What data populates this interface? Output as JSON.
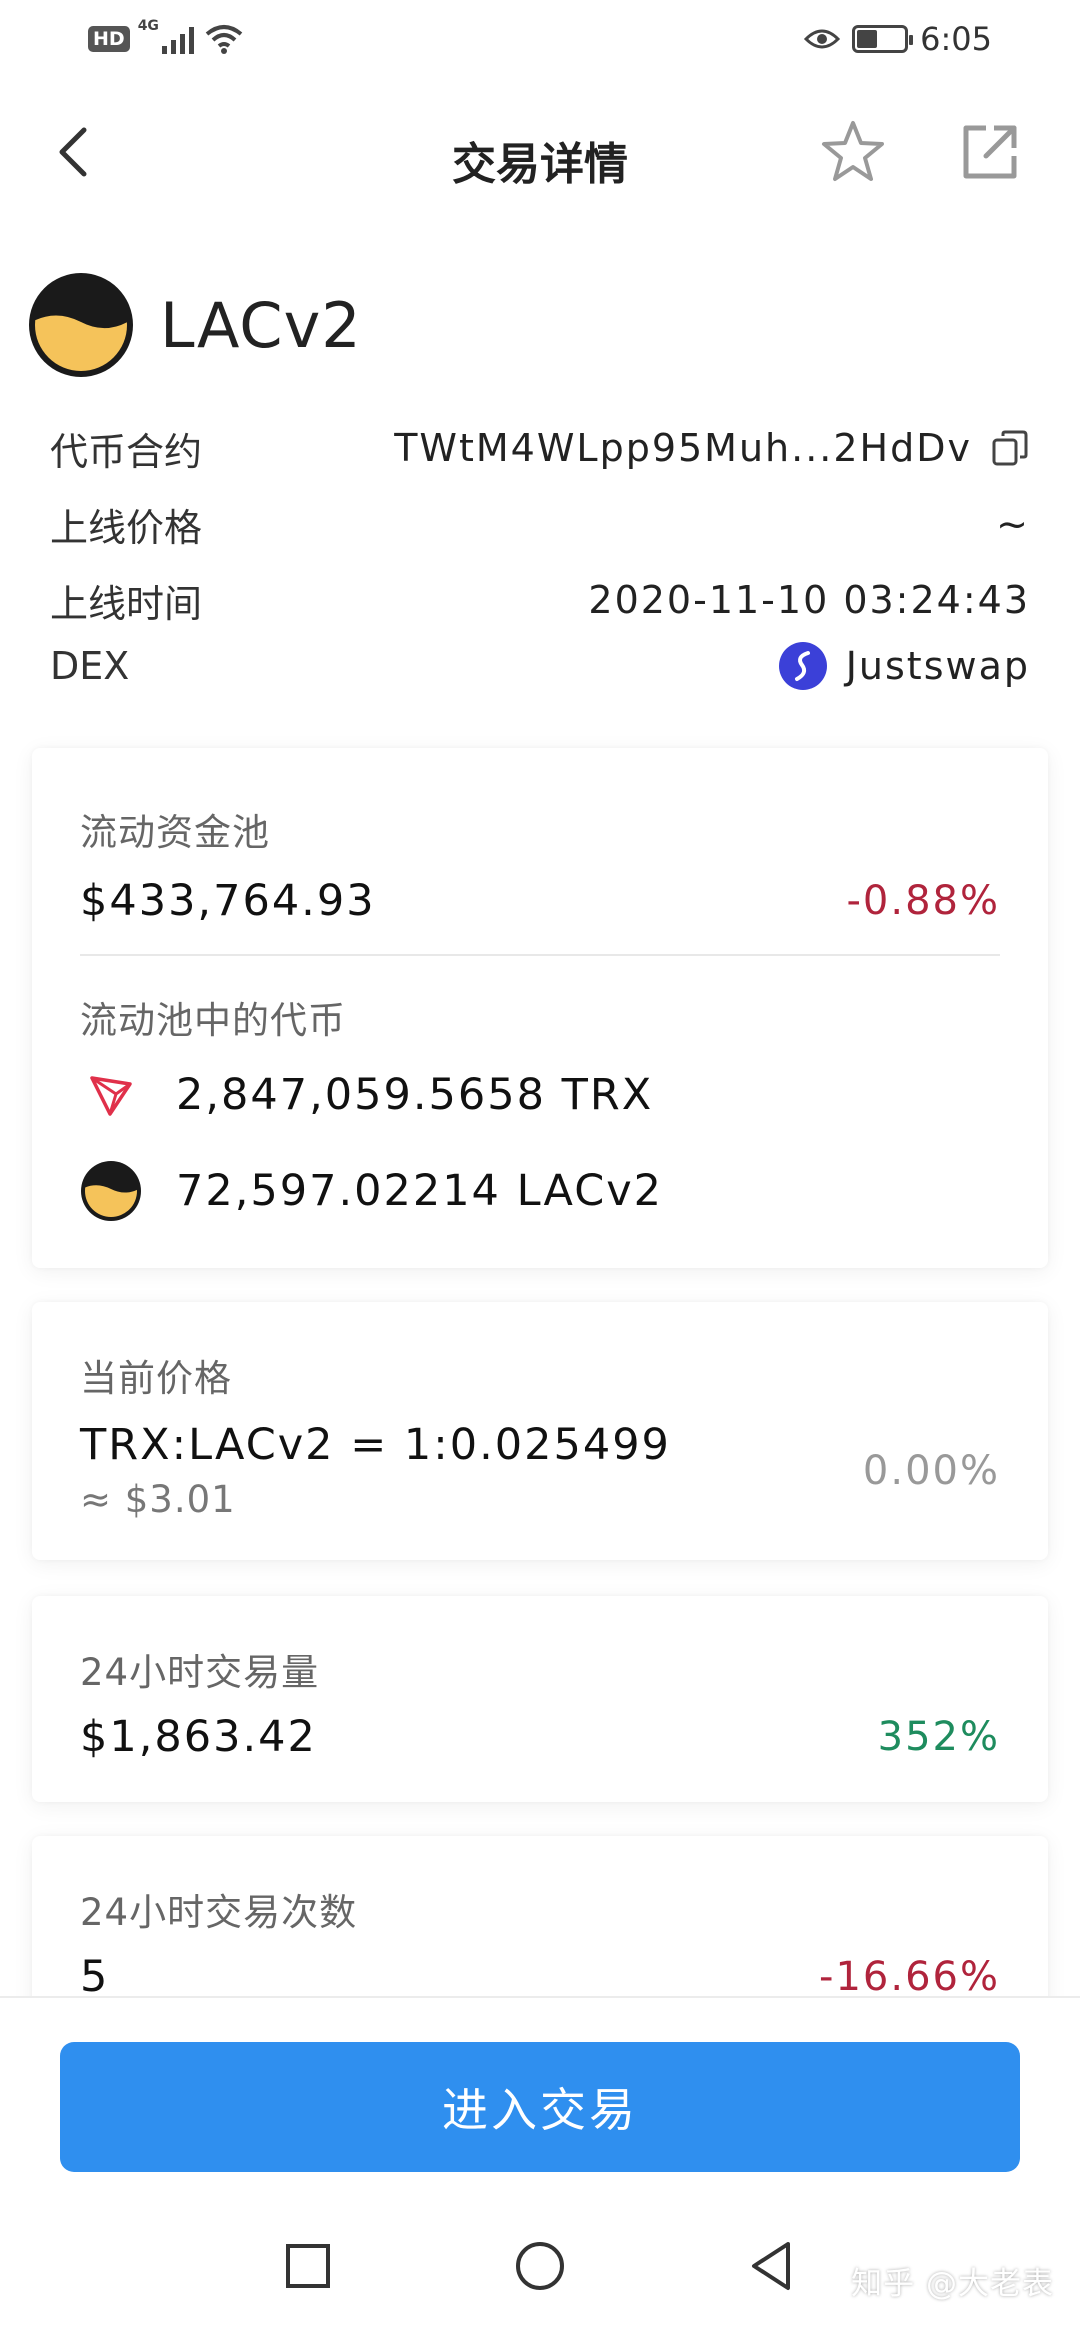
{
  "status_bar": {
    "network_badge": "HD",
    "network_gen": "4G",
    "time": "6:05"
  },
  "nav": {
    "title": "交易详情"
  },
  "token": {
    "name": "LACv2"
  },
  "info": {
    "contract_label": "代币合约",
    "contract_value": "TWtM4WLpp95Muh...2HdDv",
    "listing_price_label": "上线价格",
    "listing_price_value": "~",
    "listing_time_label": "上线时间",
    "listing_time_value": "2020-11-10 03:24:43",
    "dex_label": "DEX",
    "dex_value": "Justswap"
  },
  "liquidity": {
    "label": "流动资金池",
    "value": "$433,764.93",
    "change": "-0.88%",
    "pool_tokens_label": "流动池中的代币",
    "pool_tokens": [
      {
        "amount": "2,847,059.5658 TRX",
        "icon": "tron-icon"
      },
      {
        "amount": "72,597.02214 LACv2",
        "icon": "lacv2-icon"
      }
    ]
  },
  "price": {
    "label": "当前价格",
    "ratio": "TRX:LACv2 = 1:0.025499",
    "usd": "≈ $3.01",
    "change": "0.00%"
  },
  "volume": {
    "label": "24小时交易量",
    "value": "$1,863.42",
    "change": "352%"
  },
  "trades": {
    "label": "24小时交易次数",
    "value": "5",
    "change": "-16.66%"
  },
  "actions": {
    "trade_button": "进入交易"
  },
  "watermark": "知乎 @大老表",
  "colors": {
    "primary_button": "#2f8fef",
    "negative": "#b0243c",
    "positive": "#1e8c5e",
    "neutral": "#999999"
  }
}
